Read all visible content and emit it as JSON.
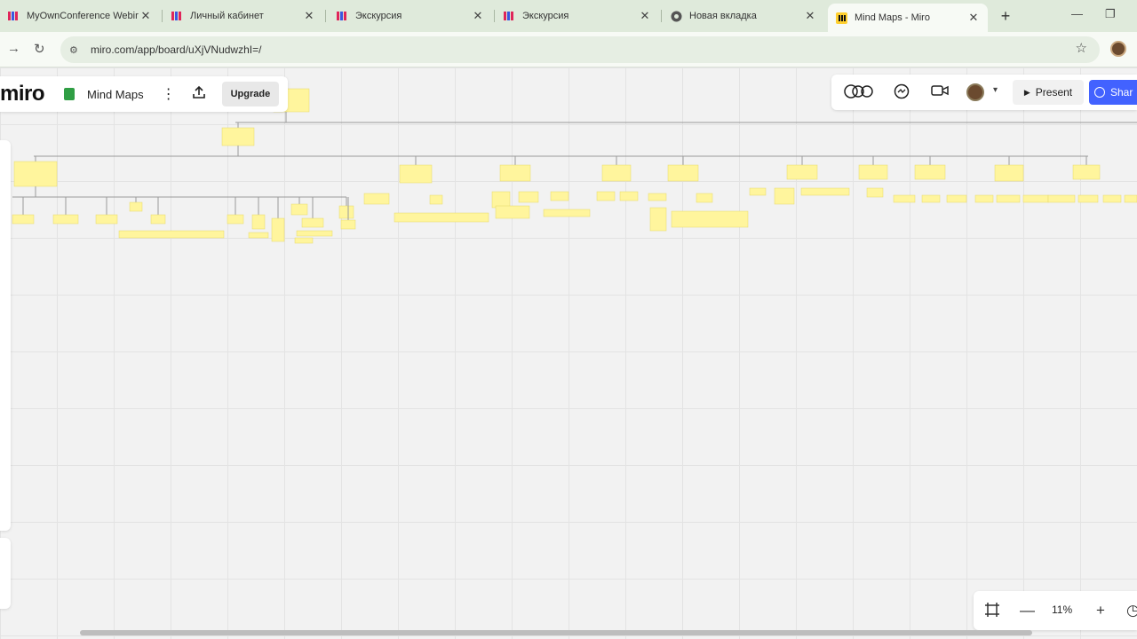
{
  "browser": {
    "tabs": [
      {
        "title": "MyOwnConference Webir",
        "favicon": "miro-icon",
        "active": false
      },
      {
        "title": "Личный кабинет",
        "favicon": "miro-icon",
        "active": false
      },
      {
        "title": "Экскурсия",
        "favicon": "miro-icon",
        "active": false
      },
      {
        "title": "Экскурсия",
        "favicon": "miro-icon",
        "active": false
      },
      {
        "title": "Новая вкладка",
        "favicon": "chrome-icon",
        "active": false
      },
      {
        "title": "Mind Maps - Miro",
        "favicon": "miro-board-icon",
        "active": true
      }
    ],
    "url": "miro.com/app/board/uXjVNudwzhI=/"
  },
  "app": {
    "logo": "miro",
    "board_name": "Mind Maps",
    "upgrade_label": "Upgrade",
    "present_label": "Present",
    "share_label": "Shar",
    "zoom_level": "11%",
    "brand_color": "#4262ff",
    "sticky_color": "#fff59d"
  }
}
